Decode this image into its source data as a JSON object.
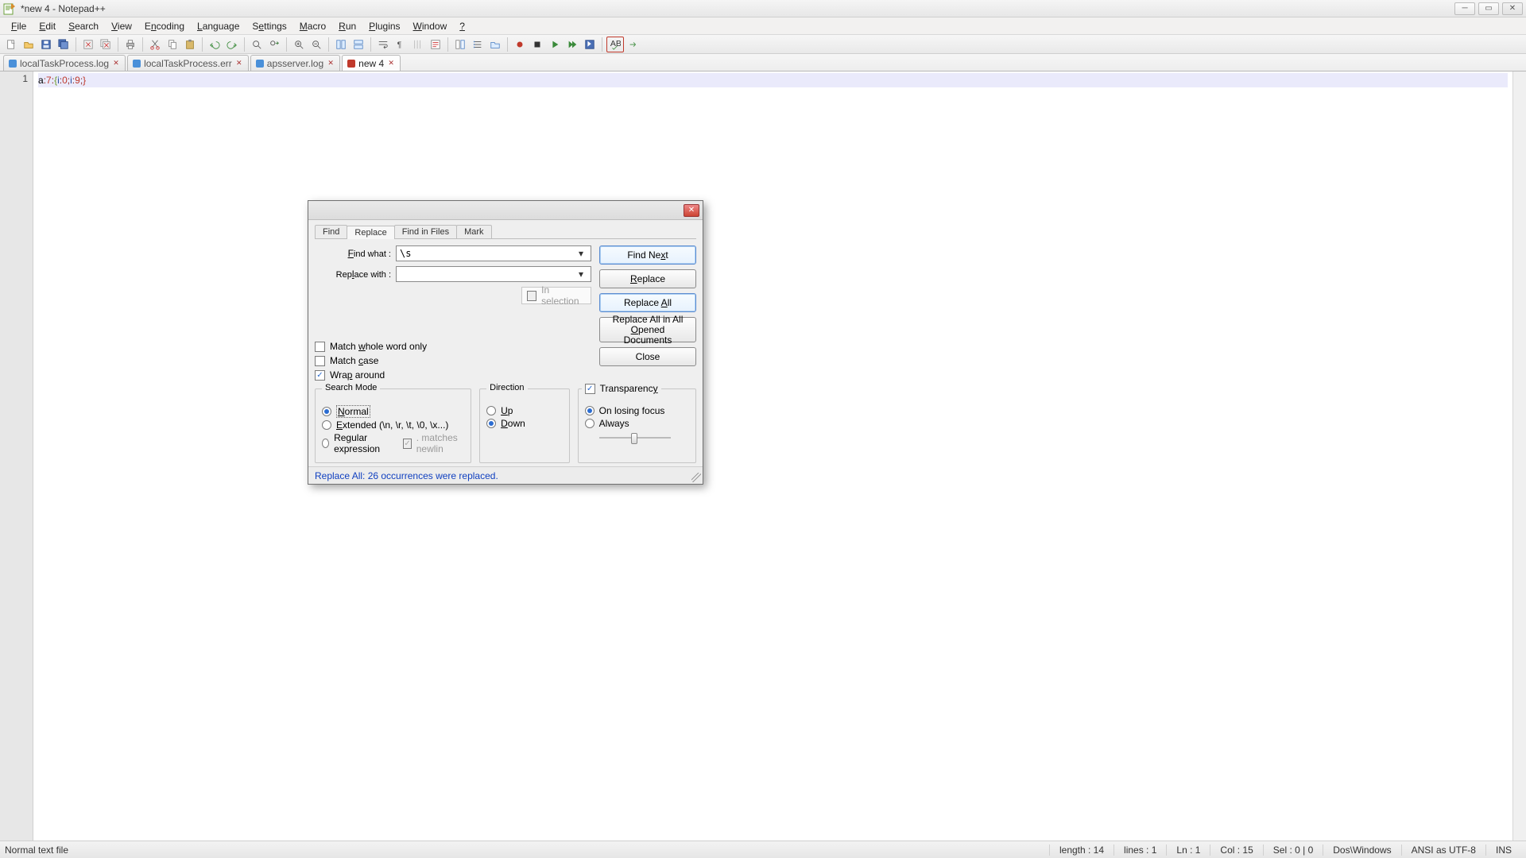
{
  "window": {
    "title": "*new  4 - Notepad++"
  },
  "menu": {
    "items": [
      "File",
      "Edit",
      "Search",
      "View",
      "Encoding",
      "Language",
      "Settings",
      "Macro",
      "Run",
      "Plugins",
      "Window",
      "?"
    ],
    "underline_idx": [
      0,
      0,
      0,
      0,
      1,
      0,
      1,
      0,
      0,
      0,
      0,
      0
    ]
  },
  "file_tabs": [
    {
      "label": "localTaskProcess.log",
      "dirty": false
    },
    {
      "label": "localTaskProcess.err",
      "dirty": false
    },
    {
      "label": "apsserver.log",
      "dirty": false
    },
    {
      "label": "new  4",
      "dirty": true,
      "active": true
    }
  ],
  "editor": {
    "gutter": [
      "1"
    ],
    "line_plain": "a:7:{i:0;i:9;}"
  },
  "dialog": {
    "tabs": [
      "Find",
      "Replace",
      "Find in Files",
      "Mark"
    ],
    "active_tab": "Replace",
    "find_label": "Find what :",
    "replace_label": "Replace with :",
    "find_value": "\\s",
    "replace_value": "",
    "in_selection": "In selection",
    "buttons": {
      "find_next": "Find Next",
      "replace": "Replace",
      "replace_all": "Replace All",
      "replace_all_open": "Replace All in All Opened Documents",
      "close": "Close"
    },
    "checks": {
      "whole_word": "Match whole word only",
      "match_case": "Match case",
      "wrap": "Wrap around"
    },
    "search_mode": {
      "title": "Search Mode",
      "normal": "Normal",
      "extended": "Extended (\\n, \\r, \\t, \\0, \\x...)",
      "regex": "Regular expression",
      "matches_newline": ". matches newlin"
    },
    "direction": {
      "title": "Direction",
      "up": "Up",
      "down": "Down"
    },
    "transparency": {
      "title": "Transparency",
      "on_lose": "On losing focus",
      "always": "Always"
    },
    "status": "Replace All: 26 occurrences were replaced."
  },
  "statusbar": {
    "left": "Normal text file",
    "length": "length : 14",
    "lines": "lines : 1",
    "ln": "Ln : 1",
    "col": "Col : 15",
    "sel": "Sel : 0 | 0",
    "eol": "Dos\\Windows",
    "enc": "ANSI as UTF-8",
    "ins": "INS"
  }
}
